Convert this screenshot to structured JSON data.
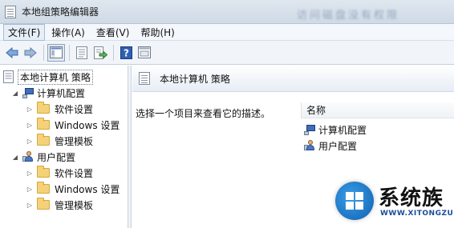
{
  "window": {
    "title": "本地组策略编辑器",
    "blurred_title_text": "访问磁盘没有权限"
  },
  "menu": [
    {
      "label": "文件(F)"
    },
    {
      "label": "操作(A)"
    },
    {
      "label": "查看(V)"
    },
    {
      "label": "帮助(H)"
    }
  ],
  "toolbar": {
    "buttons": [
      "back-icon",
      "forward-icon",
      "show-tree-icon",
      "properties-icon",
      "export-icon",
      "help-icon",
      "show-console-icon"
    ]
  },
  "tree": {
    "root": "本地计算机 策略",
    "computer_config": "计算机配置",
    "computer_children": [
      "软件设置",
      "Windows 设置",
      "管理模板"
    ],
    "user_config": "用户配置",
    "user_children": [
      "软件设置",
      "Windows 设置",
      "管理模板"
    ]
  },
  "right_pane": {
    "title": "本地计算机 策略",
    "description": "选择一个项目来查看它的描述。",
    "column_name": "名称",
    "items": [
      "计算机配置",
      "用户配置"
    ]
  },
  "watermark": {
    "name": "系统族",
    "url": "WWW.XITONGZU.COM"
  },
  "colors": {
    "titlebar": "#dfe7ef",
    "folder": "#f3d27a",
    "accent": "#1a4b9a"
  }
}
